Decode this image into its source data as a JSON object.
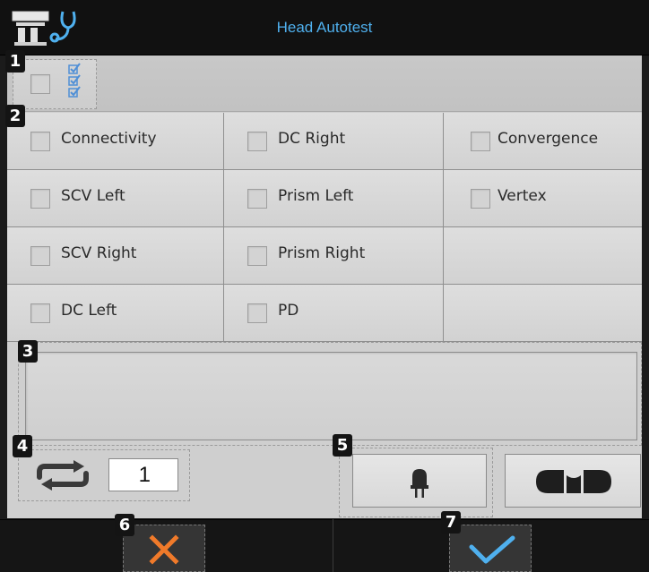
{
  "header": {
    "title": "Head Autotest",
    "title_color": "#4fb0ee",
    "device_icon": "device-stethoscope-icon"
  },
  "select_all": {
    "checked": false,
    "icon": "checklist-icon"
  },
  "tests": [
    [
      {
        "label": "Connectivity",
        "checked": false
      },
      {
        "label": "DC Right",
        "checked": false
      },
      {
        "label": "Convergence",
        "checked": false
      }
    ],
    [
      {
        "label": "SCV Left",
        "checked": false
      },
      {
        "label": "Prism Left",
        "checked": false
      },
      {
        "label": "Vertex",
        "checked": false
      }
    ],
    [
      {
        "label": "SCV Right",
        "checked": false
      },
      {
        "label": "Prism Right",
        "checked": false
      },
      {
        "label": "",
        "checked": null
      }
    ],
    [
      {
        "label": "DC Left",
        "checked": false
      },
      {
        "label": "PD",
        "checked": false
      },
      {
        "label": "",
        "checked": null
      }
    ]
  ],
  "message": "",
  "repeat": {
    "icon": "repeat-icon",
    "count": "1"
  },
  "toolbar": {
    "led_icon": "led-bulb-icon",
    "level_icon": "spirit-level-icon"
  },
  "footer": {
    "cancel_icon": "close-icon",
    "cancel_color": "#f07a2a",
    "ok_icon": "checkmark-icon",
    "ok_color": "#4fb0ee"
  },
  "markers": [
    "1",
    "2",
    "3",
    "4",
    "5",
    "6",
    "7"
  ]
}
